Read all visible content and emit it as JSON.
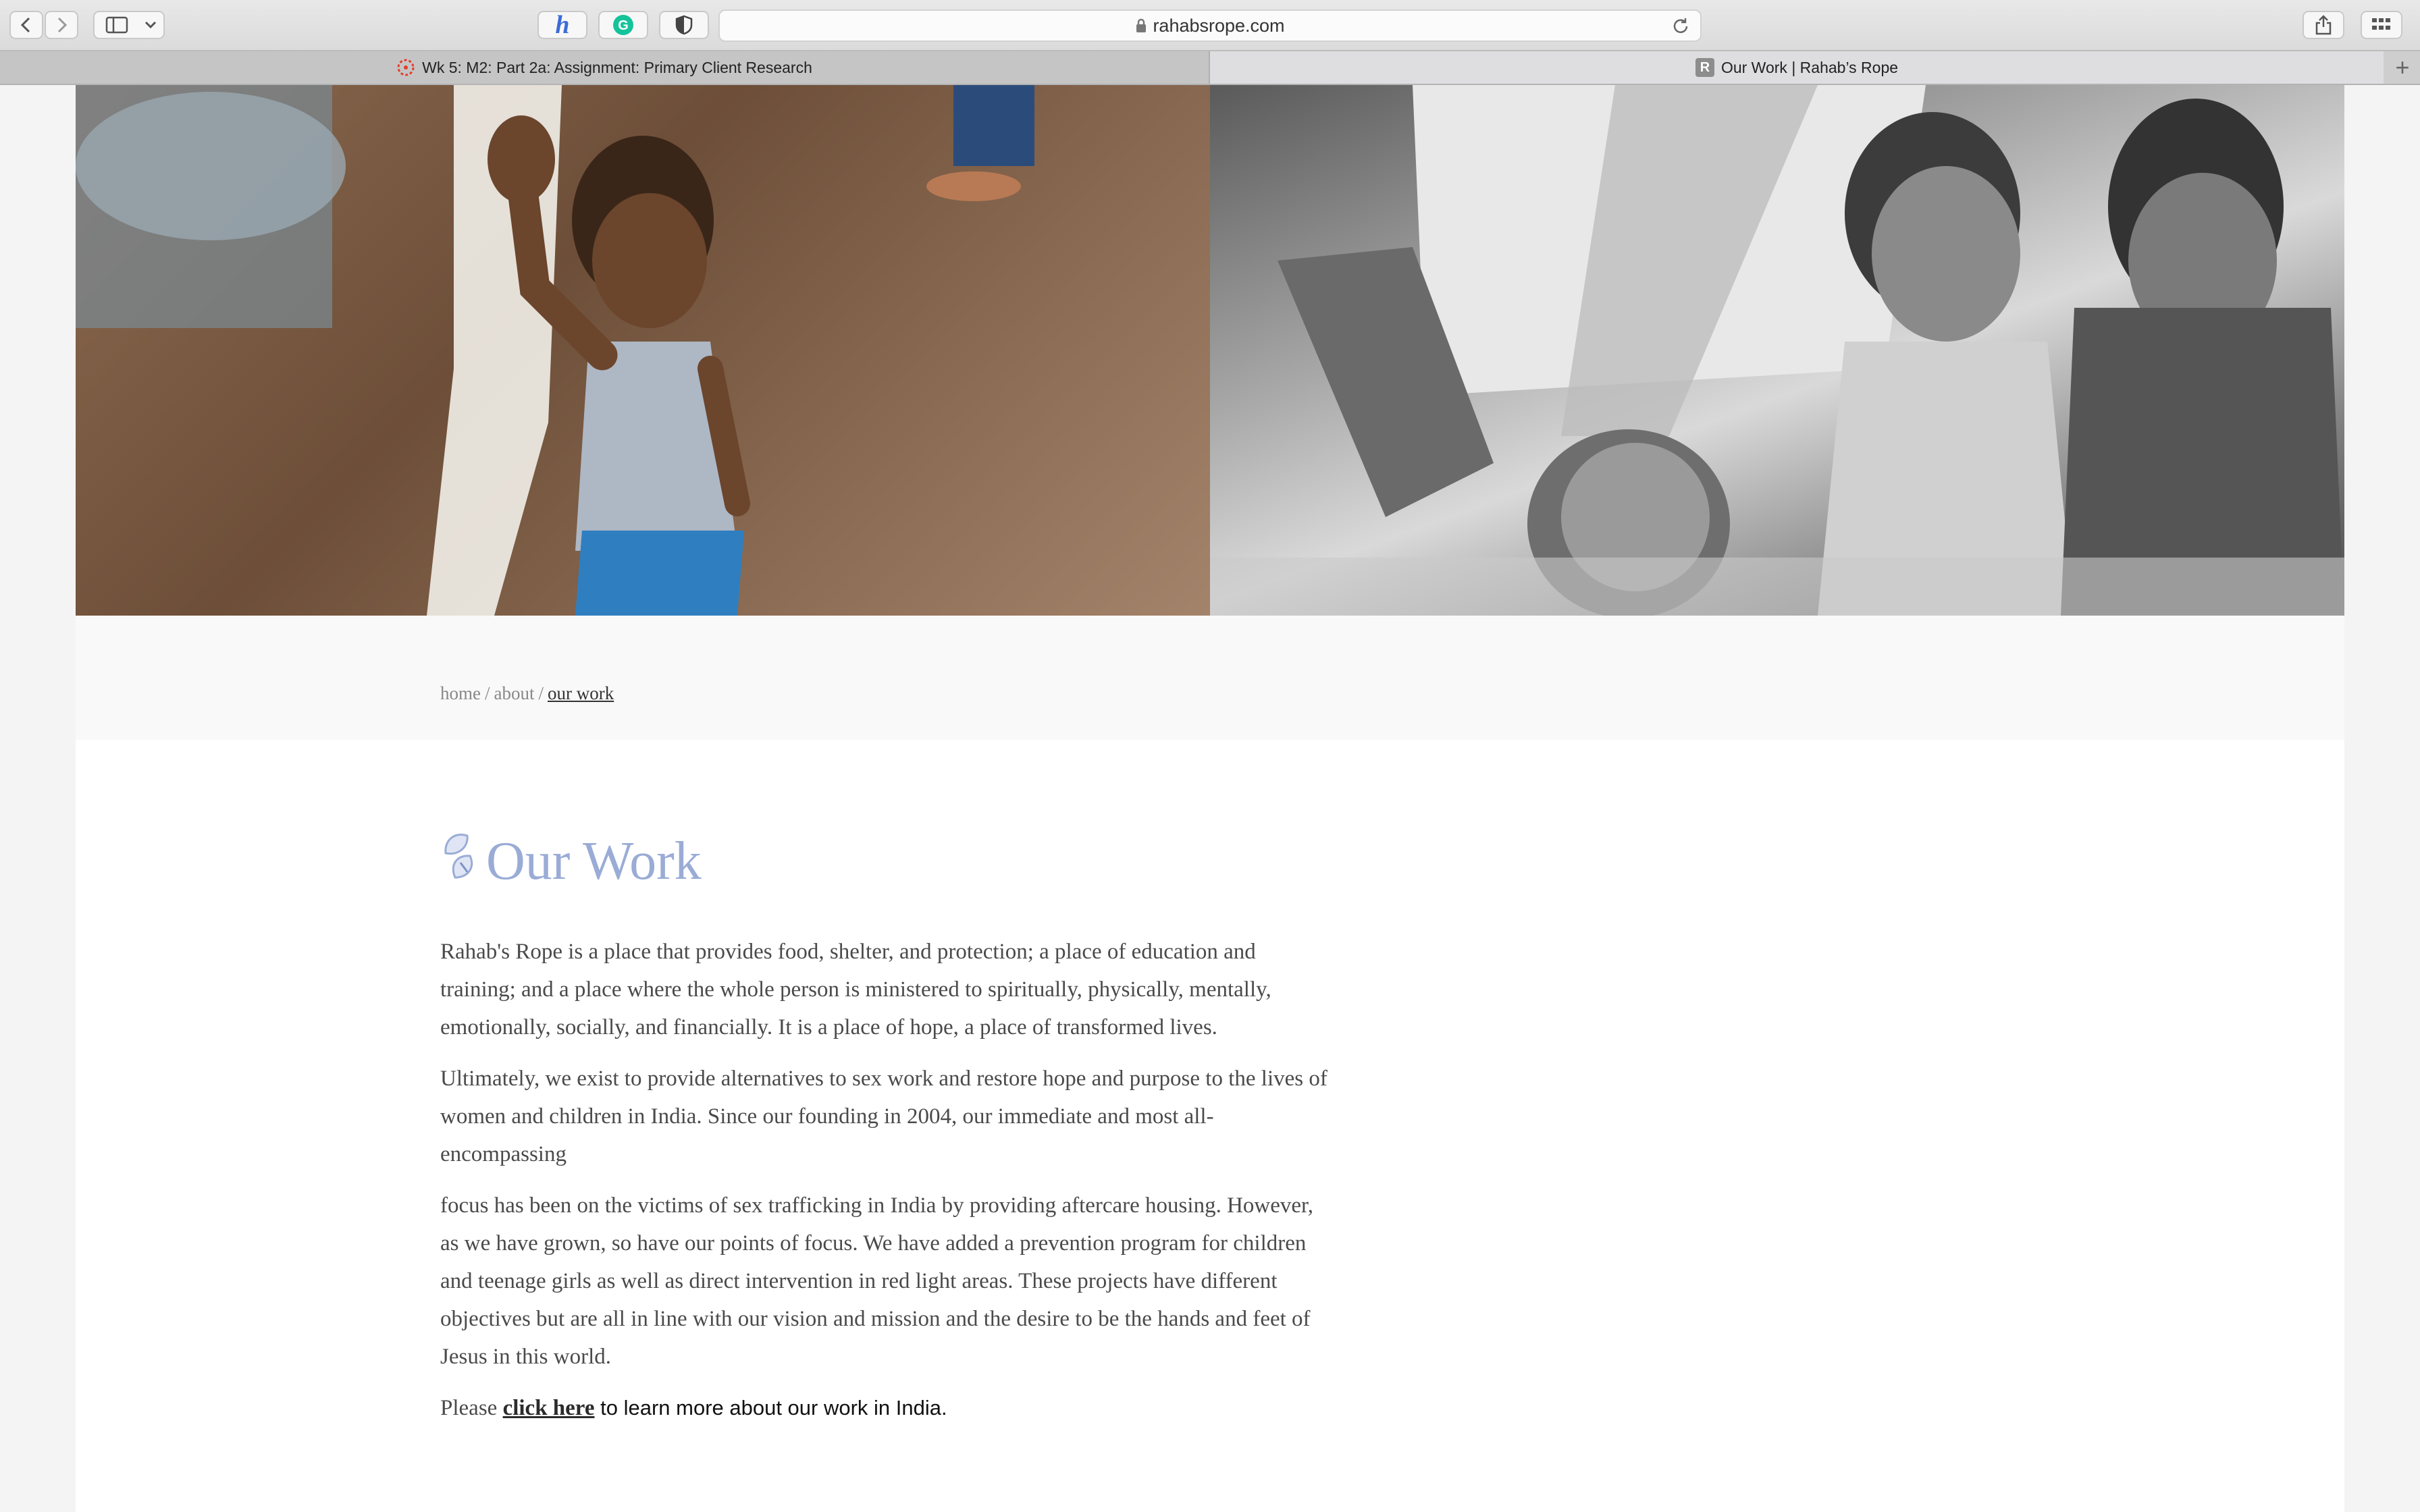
{
  "browser": {
    "url": "rahabsrope.com",
    "tabs": [
      {
        "title": "Wk 5: M2: Part 2a: Assignment: Primary Client Research",
        "icon": "canvas-logo-icon"
      },
      {
        "title": "Our Work | Rahab’s Rope",
        "icon": "site-r-icon",
        "favicon_letter": "R"
      }
    ],
    "extensions": [
      "hypothesis-extension-icon",
      "grammarly-extension-icon",
      "privacy-shield-icon"
    ]
  },
  "breadcrumb": {
    "home": "home",
    "about": "about",
    "current": "our work",
    "separator": "/"
  },
  "page": {
    "title": "Our Work",
    "paragraphs": [
      "Rahab's Rope is a place that provides food, shelter, and protection; a place of education and training; and a place where the whole person is ministered to spiritually, physically, mentally, emotionally, socially, and financially. It is a place of hope, a place of transformed lives.",
      "Ultimately, we exist to provide alternatives to sex work and restore hope and purpose to the lives of women and children in India. Since our founding in 2004, our immediate and most all-encompassing",
      "focus has been on the victims of sex trafficking in India by providing aftercare housing. However, as we have grown, so have our points of focus. We have added a prevention program for children and teenage girls as well as direct intervention in red light areas. These projects have different objectives but are all in line with our vision and mission and the desire to be the hands and feet of Jesus in this world."
    ],
    "cta": {
      "prefix": "Please ",
      "link": "click here",
      "suffix": " to learn more about our work in India."
    }
  },
  "colors": {
    "heading": "#9aacd6",
    "body_text": "#4a4a4a"
  }
}
